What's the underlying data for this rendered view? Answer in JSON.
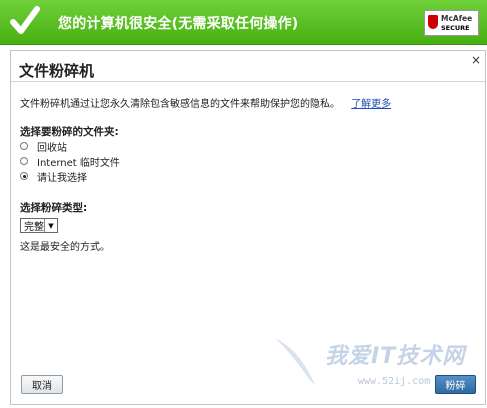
{
  "status": {
    "message": "您的计算机很安全(无需采取任何操作)",
    "badge_brand": "McAfee",
    "badge_secure": "SECURE"
  },
  "dialog": {
    "close_glyph": "×",
    "title": "文件粉碎机",
    "description": "文件粉碎机通过让您永久清除包含敏感信息的文件来帮助保护您的隐私。",
    "learn_more": "了解更多",
    "folder_section_label": "选择要粉碎的文件夹:",
    "folder_options": [
      {
        "label": "回收站",
        "checked": false
      },
      {
        "label": "Internet 临时文件",
        "checked": false
      },
      {
        "label": "请让我选择",
        "checked": true
      }
    ],
    "type_section_label": "选择粉碎类型:",
    "type_selected": "完整",
    "type_hint": "这是最安全的方式。",
    "cancel_label": "取消",
    "shred_label": "粉碎"
  },
  "watermark": {
    "text": "我爱IT技术网",
    "url": "www.52ij.com"
  },
  "colors": {
    "status_green": "#47b012",
    "link_blue": "#1a4fb5",
    "primary_button": "#2e6aa3"
  }
}
